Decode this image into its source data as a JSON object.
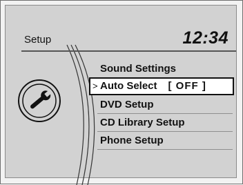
{
  "header": {
    "title": "Setup",
    "clock": "12:34"
  },
  "menu": {
    "items": [
      {
        "label": "Sound Settings",
        "value": ""
      },
      {
        "label": "Auto Select",
        "value": "[ OFF ]",
        "selected": true
      },
      {
        "label": "DVD Setup",
        "value": ""
      },
      {
        "label": "CD Library Setup",
        "value": ""
      },
      {
        "label": "Phone Setup",
        "value": ""
      }
    ]
  },
  "icons": {
    "setup": "wrench-icon",
    "selection": "pointer-icon"
  }
}
